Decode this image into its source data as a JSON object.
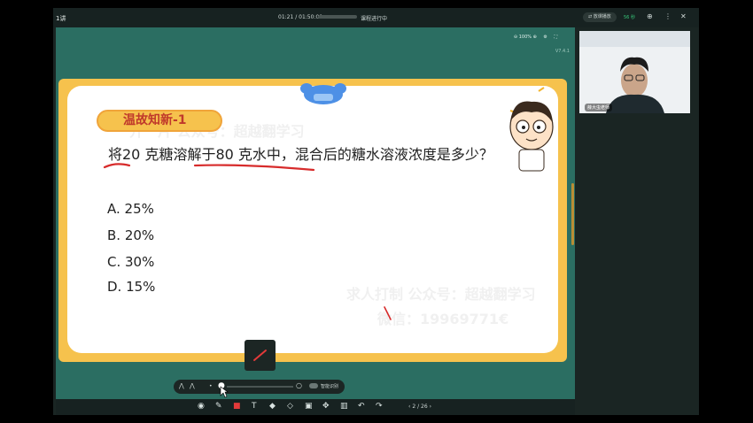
{
  "app": {
    "title": "1讲",
    "time": "01:21 / 01:50:00",
    "status": "课程进行中",
    "record_label": "放课播放",
    "signal": "56 秒"
  },
  "toolbar": {
    "zoom": "100%",
    "version": "V7.4.1"
  },
  "slide": {
    "badge": "温故知新-1",
    "question": "将20 克糖溶解于80 克水中，混合后的糖水溶液浓度是多少？",
    "options": [
      "A.  25%",
      "B.  20%",
      "C.  30%",
      "D.  15%"
    ]
  },
  "watermark": {
    "line1": "求人打制 公众号：超越翻学习",
    "line2": "微信：19969771€",
    "top": "开一片 公众号：超越翻学习"
  },
  "drawbar": {
    "smart_label": "智能识别"
  },
  "pager": {
    "current": "2",
    "total": "/ 26"
  },
  "webcam": {
    "name": "薛大虫老师"
  },
  "colors": {
    "accent": "#f6c24d",
    "background": "#2b6e62",
    "badge_text": "#c0392b"
  }
}
